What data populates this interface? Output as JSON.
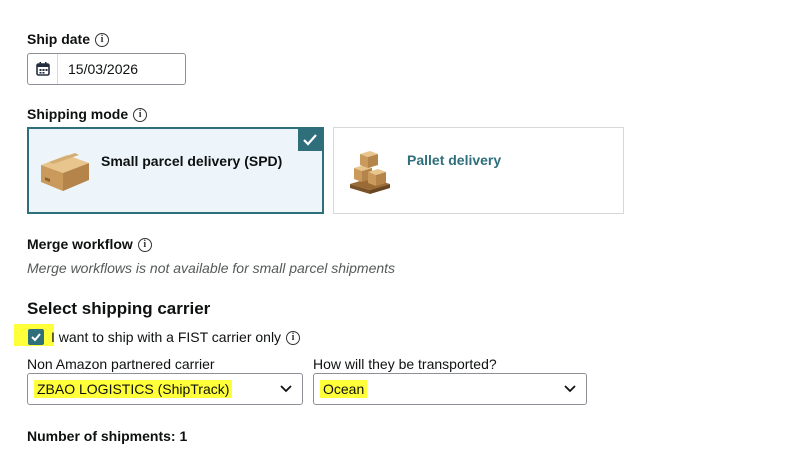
{
  "ship_date": {
    "label": "Ship date",
    "value": "15/03/2026"
  },
  "shipping_mode": {
    "label": "Shipping mode",
    "options": [
      {
        "label": "Small parcel delivery (SPD)",
        "selected": true
      },
      {
        "label": "Pallet delivery",
        "selected": false
      }
    ]
  },
  "merge_workflow": {
    "label": "Merge workflow",
    "note": "Merge workflows is not available for small parcel shipments"
  },
  "carrier": {
    "section_title": "Select shipping carrier",
    "fist_checkbox_label": "I want to ship with a FIST carrier only",
    "fist_checked": true,
    "non_partnered_label": "Non Amazon partnered carrier",
    "non_partnered_value": "ZBAO LOGISTICS (ShipTrack)",
    "transport_label": "How will they be transported?",
    "transport_value": "Ocean"
  },
  "shipments": {
    "label": "Number of shipments: 1"
  },
  "colors": {
    "accent": "#2f6f7b",
    "highlight": "#ffff3a",
    "selected_bg": "#edf5fb"
  }
}
